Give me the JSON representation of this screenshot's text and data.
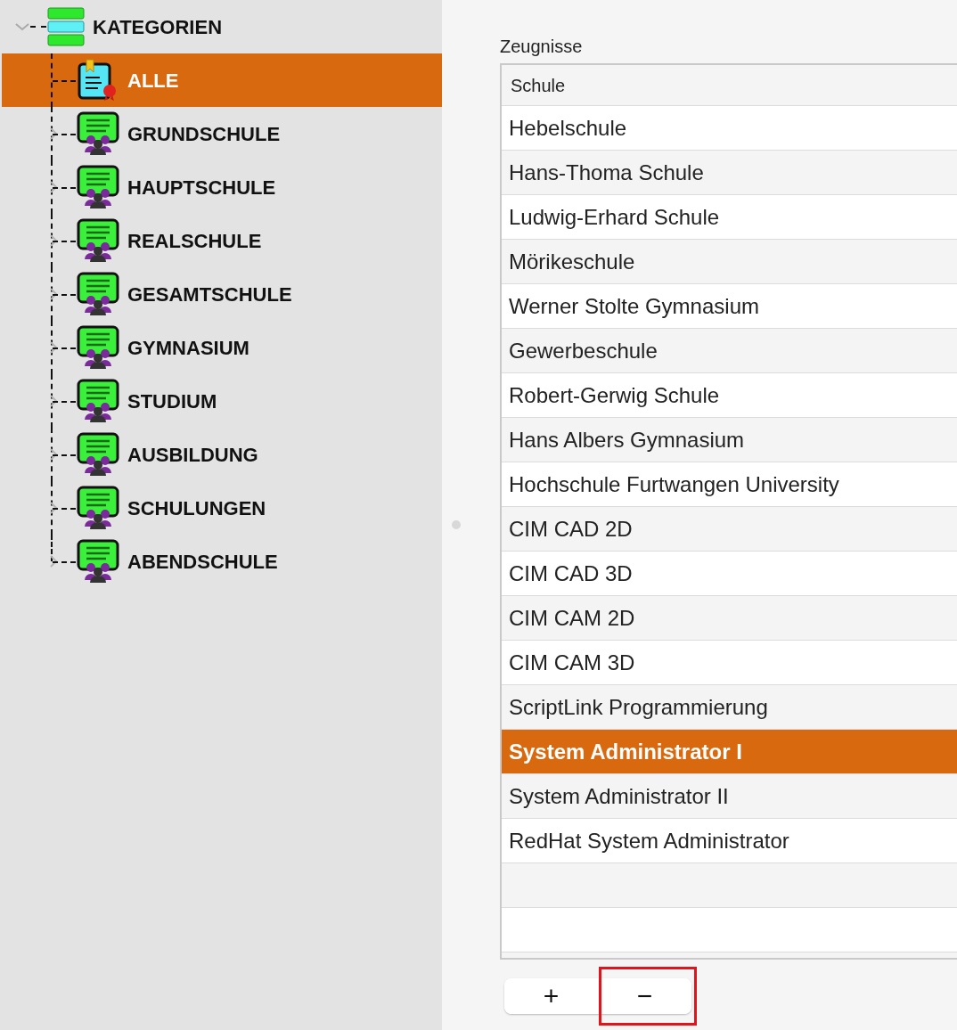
{
  "tree": {
    "root": {
      "label": "KATEGORIEN",
      "expanded": true,
      "children": [
        {
          "label": "ALLE",
          "kind": "certificate",
          "selected": true
        },
        {
          "label": "GRUNDSCHULE",
          "kind": "group",
          "selected": false,
          "expanded": false
        },
        {
          "label": "HAUPTSCHULE",
          "kind": "group",
          "selected": false,
          "expanded": false
        },
        {
          "label": "REALSCHULE",
          "kind": "group",
          "selected": false,
          "expanded": false
        },
        {
          "label": "GESAMTSCHULE",
          "kind": "group",
          "selected": false,
          "expanded": false
        },
        {
          "label": "GYMNASIUM",
          "kind": "group",
          "selected": false,
          "expanded": false
        },
        {
          "label": "STUDIUM",
          "kind": "group",
          "selected": false,
          "expanded": false
        },
        {
          "label": "AUSBILDUNG",
          "kind": "group",
          "selected": false,
          "expanded": false
        },
        {
          "label": "SCHULUNGEN",
          "kind": "group",
          "selected": false,
          "expanded": false
        },
        {
          "label": "ABENDSCHULE",
          "kind": "group",
          "selected": false,
          "expanded": false
        }
      ]
    }
  },
  "table": {
    "title": "Zeugnisse",
    "columns": [
      "Schule"
    ],
    "rows": [
      {
        "cells": [
          "Hebelschule"
        ],
        "selected": false
      },
      {
        "cells": [
          "Hans-Thoma Schule"
        ],
        "selected": false
      },
      {
        "cells": [
          "Ludwig-Erhard Schule"
        ],
        "selected": false
      },
      {
        "cells": [
          "Mörikeschule"
        ],
        "selected": false
      },
      {
        "cells": [
          "Werner Stolte Gymnasium"
        ],
        "selected": false
      },
      {
        "cells": [
          "Gewerbeschule"
        ],
        "selected": false
      },
      {
        "cells": [
          "Robert-Gerwig Schule"
        ],
        "selected": false
      },
      {
        "cells": [
          "Hans Albers Gymnasium"
        ],
        "selected": false
      },
      {
        "cells": [
          "Hochschule Furtwangen University"
        ],
        "selected": false
      },
      {
        "cells": [
          "CIM CAD 2D"
        ],
        "selected": false
      },
      {
        "cells": [
          "CIM CAD 3D"
        ],
        "selected": false
      },
      {
        "cells": [
          "CIM CAM 2D"
        ],
        "selected": false
      },
      {
        "cells": [
          "CIM CAM 3D"
        ],
        "selected": false
      },
      {
        "cells": [
          "ScriptLink Programmierung"
        ],
        "selected": false
      },
      {
        "cells": [
          "System Administrator I"
        ],
        "selected": true
      },
      {
        "cells": [
          "System Administrator II"
        ],
        "selected": false
      },
      {
        "cells": [
          "RedHat System Administrator"
        ],
        "selected": false
      }
    ]
  },
  "buttons": [
    {
      "label": "+",
      "highlighted": false
    },
    {
      "label": "−",
      "highlighted": true
    }
  ]
}
